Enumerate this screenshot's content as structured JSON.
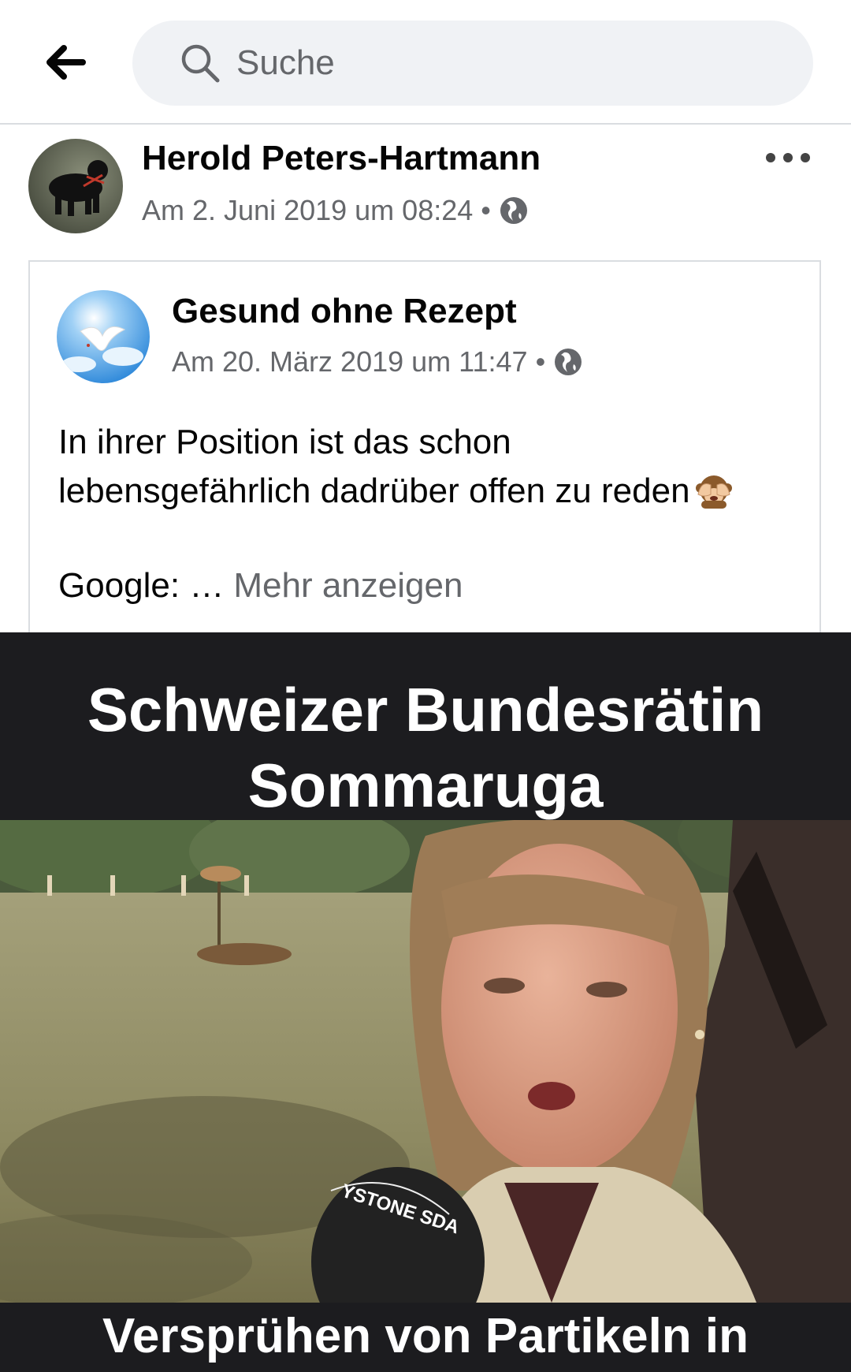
{
  "search": {
    "placeholder": "Suche"
  },
  "post": {
    "author": "Herold Peters-Hartmann",
    "timestamp": "Am 2. Juni 2019 um 08:24",
    "separator": "•",
    "privacy_icon": "globe-icon"
  },
  "shared": {
    "page_name": "Gesund ohne Rezept",
    "timestamp": "Am 20. März 2019 um 11:47",
    "separator": "•",
    "text_line1": "In ihrer Position ist das schon",
    "text_line2": "lebensgefährlich dadrüber offen zu reden",
    "emoji": "see-no-evil-monkey-icon",
    "google_prefix": "Google: …",
    "more_link": "Mehr anzeigen"
  },
  "video": {
    "title_line1": "Schweizer Bundesrätin",
    "title_line2": "Sommaruga",
    "microphone_label": "YSTONE SDA",
    "caption": "Versprühen von Partikeln in"
  },
  "colors": {
    "text_primary": "#050505",
    "text_secondary": "#65676b",
    "search_bg": "#f0f2f5",
    "divider": "#dadde1",
    "video_bg": "#1c1c1f"
  }
}
